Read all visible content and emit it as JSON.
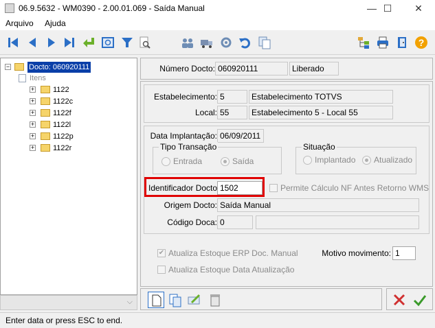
{
  "window": {
    "title": "06.9.5632 - WM0390 - 2.00.01.069 - Saída Manual",
    "minimize": "—",
    "maximize": "☐",
    "close": "✕"
  },
  "menu": {
    "items": [
      "Arquivo",
      "Ajuda"
    ]
  },
  "tree": {
    "root": "Docto: 060920111",
    "itens_label": "Itens",
    "children": [
      "1122",
      "1122c",
      "1122f",
      "1122l",
      "1122p",
      "1122r"
    ],
    "bottom_chevron": "⌵"
  },
  "header": {
    "numero_label": "Número Docto:",
    "numero_value": "060920111",
    "status_value": "Liberado"
  },
  "location": {
    "estab_label": "Estabelecimento:",
    "estab_code": "5",
    "estab_name": "Estabelecimento TOTVS",
    "local_label": "Local:",
    "local_code": "55",
    "local_name": "Estabelecimento 5 - Local 55"
  },
  "details": {
    "data_label": "Data Implantação:",
    "data_value": "06/09/2011",
    "tipo_label": "Tipo Transação",
    "entrada": "Entrada",
    "saida": "Saída",
    "situacao_label": "Situação",
    "implantado": "Implantado",
    "atualizado": "Atualizado",
    "identificador_label": "Identificador Docto:",
    "identificador_value": "1502",
    "permite_label": "Permite Cálculo NF Antes Retorno WMS",
    "origem_label": "Origem Docto:",
    "origem_value": "Saída Manual",
    "codigo_label": "Código Doca:",
    "codigo_value": "0"
  },
  "options": {
    "atualiza_erp": "Atualiza Estoque ERP Doc. Manual",
    "atualiza_data": "Atualiza Estoque Data Atualização",
    "motivo_label": "Motivo movimento:",
    "motivo_value": "1",
    "check_mark": "✔"
  },
  "statusbar": {
    "text": "Enter data or press ESC to end."
  },
  "colors": {
    "accent_blue": "#2b6fc6",
    "highlight": "#e00000",
    "confirm_green": "#3a9a2a",
    "cancel_red": "#d03030"
  }
}
